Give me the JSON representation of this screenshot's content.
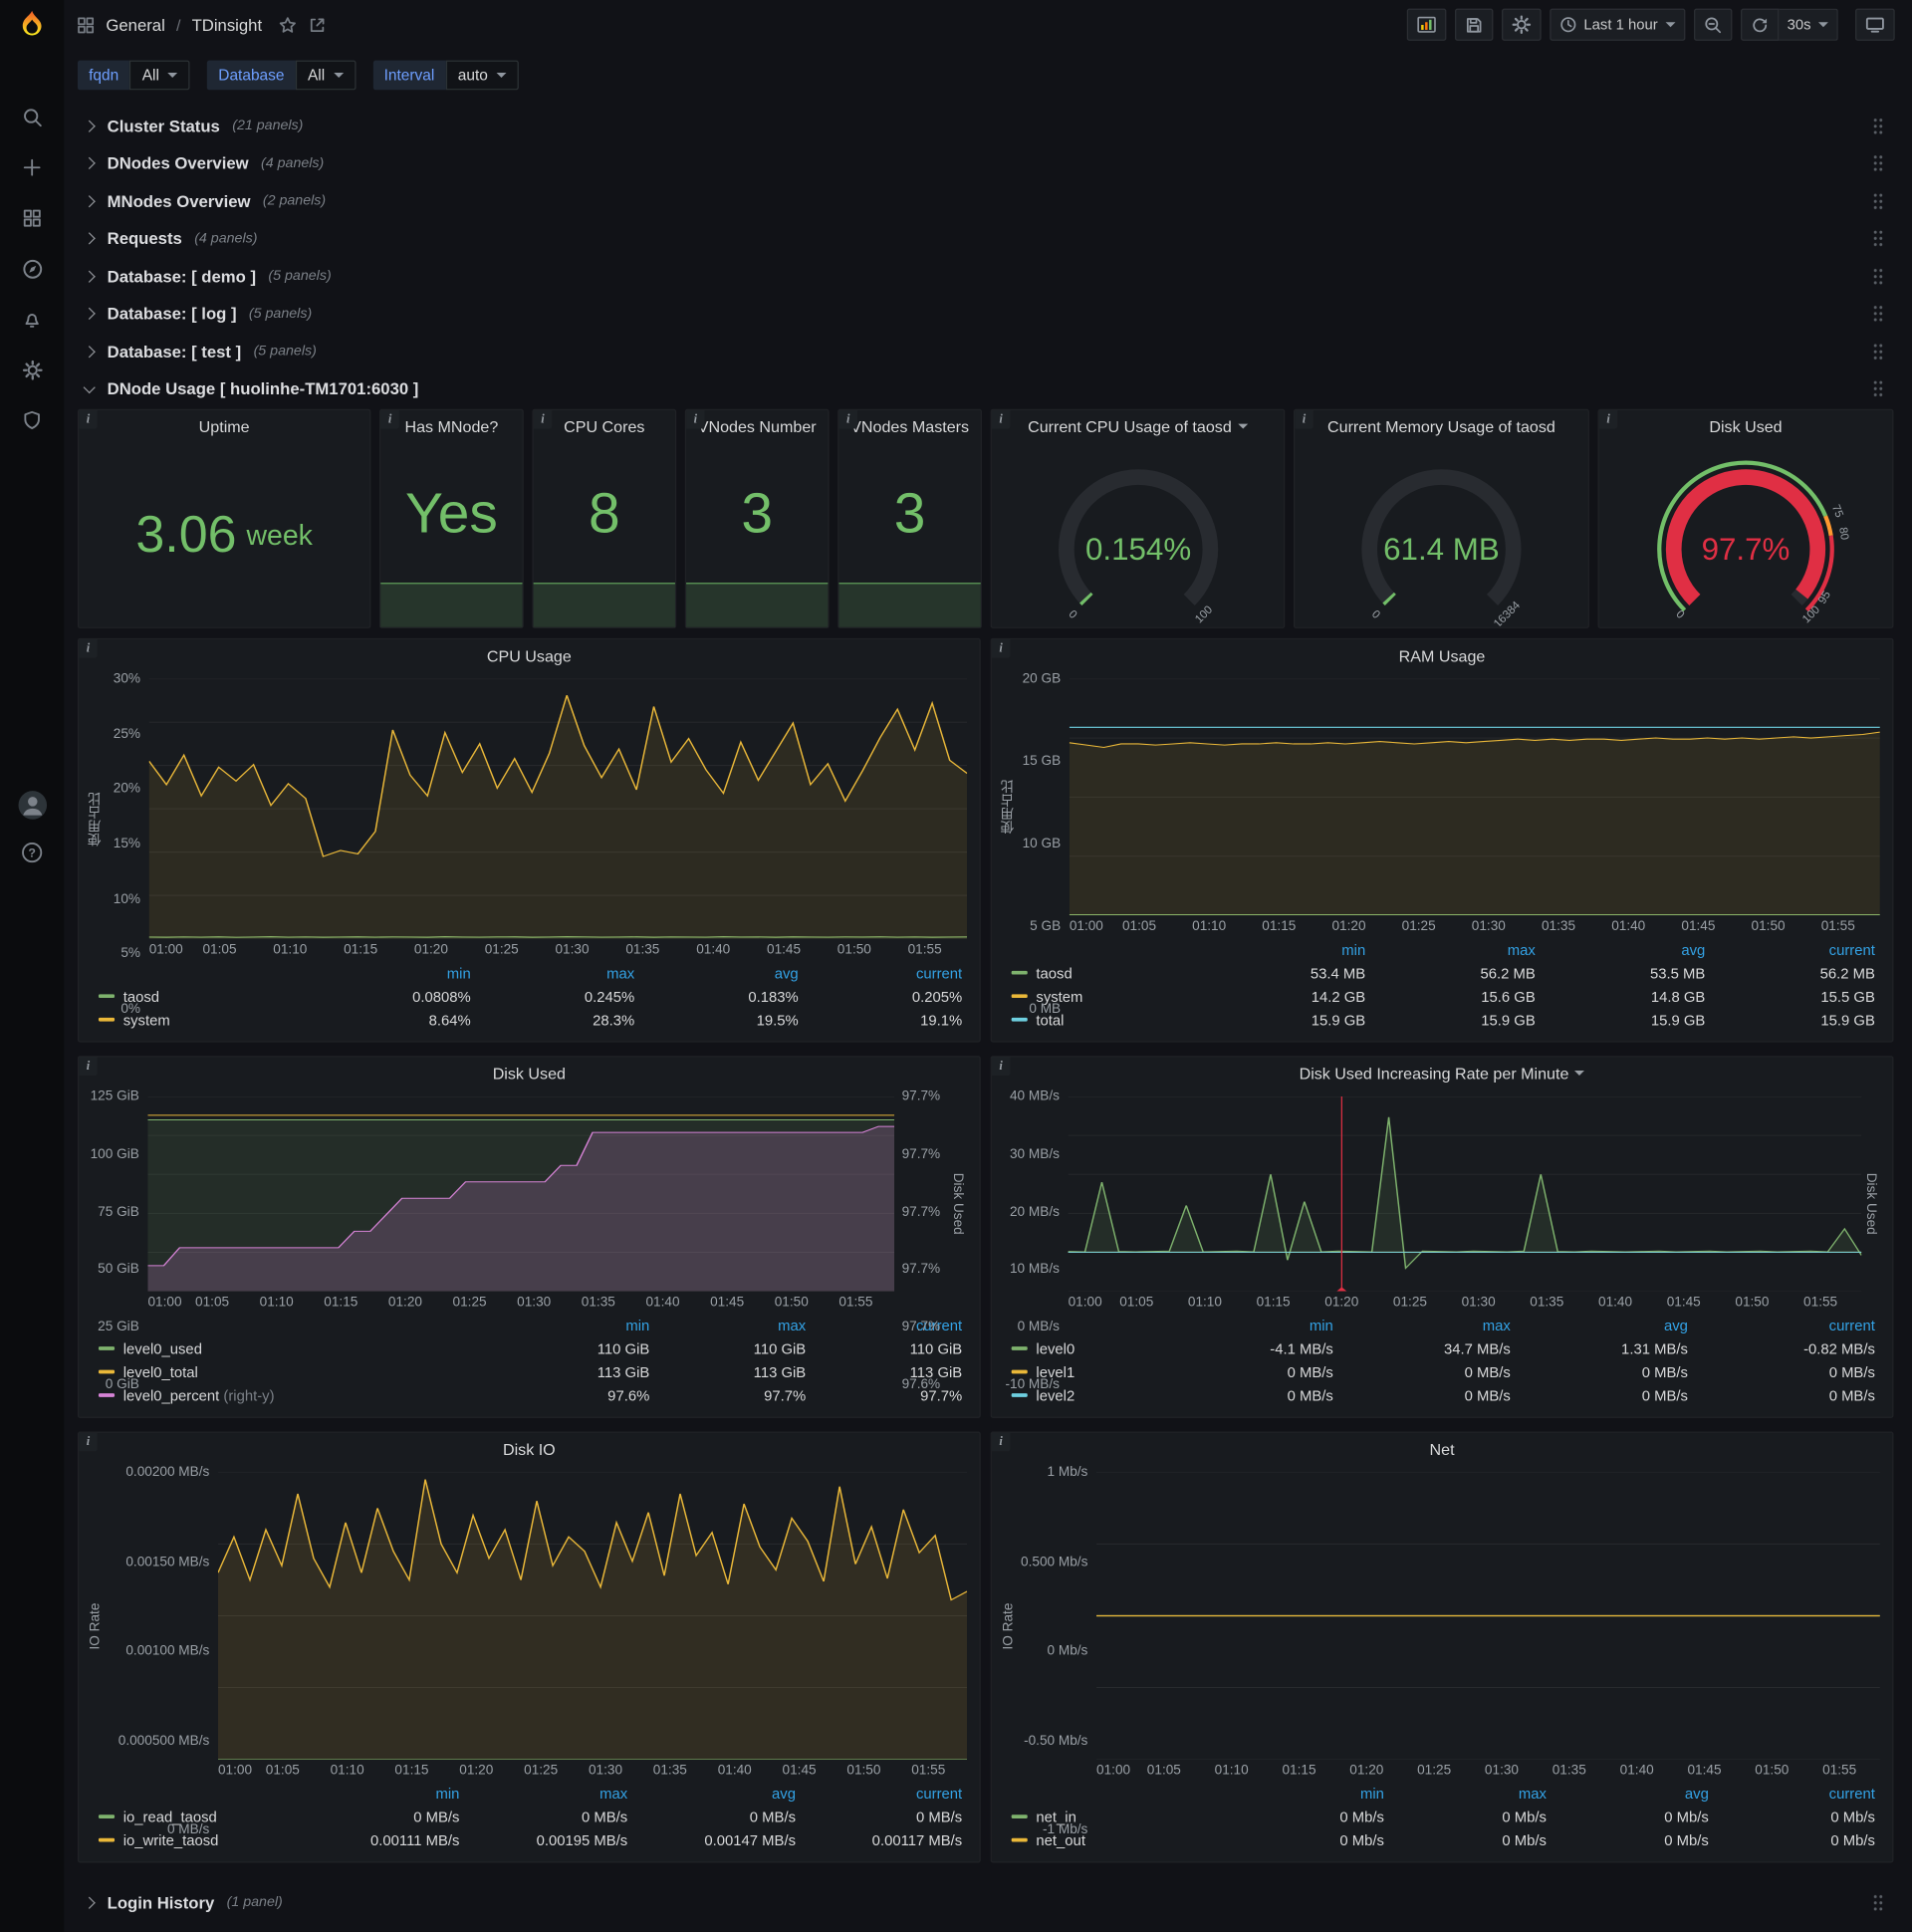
{
  "colors": {
    "brand_orange": "#f05a28",
    "green": "#73bf69",
    "series_green": "#7eb26d",
    "yellow": "#eab839",
    "cyan": "#6ed0e0",
    "pink": "#d683d6",
    "red": "#e02f44",
    "orange": "#ff9830",
    "legend_header_blue": "#33a2e5",
    "variable_blue": "#6e9fff"
  },
  "nav": {
    "section": "General",
    "separator": "/",
    "title": "TDinsight",
    "time_picker": "Last 1 hour",
    "refresh": "30s"
  },
  "variables": [
    {
      "name": "fqdn",
      "value": "All"
    },
    {
      "name": "Database",
      "value": "All"
    },
    {
      "name": "Interval",
      "value": "auto"
    }
  ],
  "rows_collapsed_top": [
    {
      "title": "Cluster Status",
      "count": "(21 panels)"
    },
    {
      "title": "DNodes Overview",
      "count": "(4 panels)"
    },
    {
      "title": "MNodes Overview",
      "count": "(2 panels)"
    },
    {
      "title": "Requests",
      "count": "(4 panels)"
    },
    {
      "title": "Database: [ demo ]",
      "count": "(5 panels)"
    },
    {
      "title": "Database: [ log ]",
      "count": "(5 panels)"
    },
    {
      "title": "Database: [ test ]",
      "count": "(5 panels)"
    }
  ],
  "expanded_row": {
    "title": "DNode Usage [ huolinhe-TM1701:6030 ]"
  },
  "rows_collapsed_bottom": [
    {
      "title": "Login History",
      "count": "(1 panel)"
    }
  ],
  "stats": {
    "uptime": {
      "title": "Uptime",
      "value": "3.06",
      "unit": "week"
    },
    "has_mnode": {
      "title": "Has MNode?",
      "value": "Yes"
    },
    "cpu_cores": {
      "title": "CPU Cores",
      "value": "8"
    },
    "vnodes_number": {
      "title": "VNodes Number",
      "value": "3"
    },
    "vnodes_masters": {
      "title": "VNodes Masters",
      "value": "3"
    }
  },
  "gauges": {
    "cpu": {
      "title": "Current CPU Usage of taosd",
      "value": "0.154%",
      "fraction": 0.0015,
      "min_label": "0",
      "max_label": "100",
      "color": "#73bf69",
      "caret": true
    },
    "mem": {
      "title": "Current Memory Usage of taosd",
      "value": "61.4 MB",
      "fraction": 0.0037,
      "min_label": "0",
      "max_label": "16384",
      "color": "#73bf69"
    },
    "disk": {
      "title": "Disk Used",
      "value": "97.7%",
      "fraction": 0.977,
      "min_label": "0",
      "max_label": "100",
      "color": "#e02f44",
      "thresholds": [
        {
          "from": 0,
          "to": 0.75,
          "color": "#73bf69"
        },
        {
          "from": 0.75,
          "to": 0.8,
          "color": "#ff9830"
        },
        {
          "from": 0.8,
          "to": 1,
          "color": "#e02f44"
        }
      ],
      "threshold_labels": [
        {
          "frac": 0.75,
          "label": "75"
        },
        {
          "frac": 0.8,
          "label": "80"
        },
        {
          "frac": 0.95,
          "label": "95"
        }
      ]
    }
  },
  "chart_data": [
    {
      "id": "cpu_usage",
      "type": "line",
      "title": "CPU Usage",
      "ylabel": "使用占比",
      "ylim": [
        0,
        30
      ],
      "ytick_w": 36,
      "yticks": [
        {
          "v": 0,
          "label": "0%"
        },
        {
          "v": 5,
          "label": "5%"
        },
        {
          "v": 10,
          "label": "10%"
        },
        {
          "v": 15,
          "label": "15%"
        },
        {
          "v": 20,
          "label": "20%"
        },
        {
          "v": 25,
          "label": "25%"
        },
        {
          "v": 30,
          "label": "30%"
        }
      ],
      "xticks": [
        "01:00",
        "01:05",
        "01:10",
        "01:15",
        "01:20",
        "01:25",
        "01:30",
        "01:35",
        "01:40",
        "01:45",
        "01:50",
        "01:55"
      ],
      "x_tick_minutes": 5,
      "x_total_minutes": 58,
      "legend_columns": [
        "min",
        "max",
        "avg",
        "current"
      ],
      "series": [
        {
          "name": "taosd",
          "color": "#7eb26d",
          "fill": 0.1,
          "stats": [
            "0.0808%",
            "0.245%",
            "0.183%",
            "0.205%"
          ],
          "values": [
            0.2,
            0.18,
            0.21,
            0.19,
            0.22,
            0.17,
            0.2,
            0.23,
            0.19,
            0.21,
            0.18,
            0.2,
            0.22,
            0.19,
            0.21,
            0.2,
            0.18,
            0.23,
            0.2,
            0.19,
            0.21,
            0.22,
            0.18,
            0.2,
            0.24,
            0.21,
            0.19,
            0.2,
            0.22,
            0.18,
            0.21,
            0.2,
            0.19,
            0.23,
            0.2,
            0.21,
            0.18,
            0.22,
            0.2,
            0.19,
            0.21,
            0.2,
            0.22,
            0.19,
            0.21,
            0.18,
            0.2,
            0.21
          ]
        },
        {
          "name": "system",
          "color": "#eab839",
          "fill": 0.1,
          "stats": [
            "8.64%",
            "28.3%",
            "19.5%",
            "19.1%"
          ],
          "values": [
            20.5,
            17.8,
            21.2,
            16.5,
            19.8,
            18.2,
            20.1,
            15.4,
            17.9,
            16.2,
            9.5,
            10.2,
            9.8,
            12.4,
            24.1,
            18.9,
            16.5,
            23.8,
            19.2,
            22.5,
            17.4,
            20.8,
            16.9,
            21.4,
            28.1,
            22.3,
            18.6,
            21.9,
            17.2,
            26.8,
            20.4,
            23.1,
            19.5,
            16.8,
            22.7,
            18.3,
            21.6,
            24.9,
            17.8,
            20.2,
            15.9,
            19.4,
            23.2,
            26.5,
            21.8,
            27.2,
            20.6,
            19.1
          ]
        }
      ]
    },
    {
      "id": "ram_usage",
      "type": "line",
      "title": "RAM Usage",
      "ylabel": "使用占比",
      "ylim": [
        0,
        20
      ],
      "ytick_w": 42,
      "yticks": [
        {
          "v": 0,
          "label": "0 MB"
        },
        {
          "v": 5,
          "label": "5 GB"
        },
        {
          "v": 10,
          "label": "10 GB"
        },
        {
          "v": 15,
          "label": "15 GB"
        },
        {
          "v": 20,
          "label": "20 GB"
        }
      ],
      "xticks": [
        "01:00",
        "01:05",
        "01:10",
        "01:15",
        "01:20",
        "01:25",
        "01:30",
        "01:35",
        "01:40",
        "01:45",
        "01:50",
        "01:55"
      ],
      "x_tick_minutes": 5,
      "x_total_minutes": 58,
      "legend_columns": [
        "min",
        "max",
        "avg",
        "current"
      ],
      "series": [
        {
          "name": "taosd",
          "color": "#7eb26d",
          "fill": 0.1,
          "stats": [
            "53.4 MB",
            "56.2 MB",
            "53.5 MB",
            "56.2 MB"
          ],
          "constant": 0.054,
          "points": 48
        },
        {
          "name": "system",
          "color": "#eab839",
          "fill": 0.1,
          "stats": [
            "14.2 GB",
            "15.6 GB",
            "14.8 GB",
            "15.5 GB"
          ],
          "values": [
            14.6,
            14.4,
            14.2,
            14.5,
            14.5,
            14.4,
            14.5,
            14.6,
            14.5,
            14.4,
            14.5,
            14.5,
            14.6,
            14.5,
            14.5,
            14.6,
            14.5,
            14.6,
            14.7,
            14.6,
            14.5,
            14.6,
            14.7,
            14.6,
            14.7,
            14.8,
            14.9,
            14.8,
            14.9,
            14.8,
            14.9,
            14.9,
            14.8,
            14.9,
            15.0,
            14.9,
            14.9,
            15.0,
            14.9,
            15.0,
            14.9,
            15.0,
            15.1,
            15.0,
            15.1,
            15.2,
            15.3,
            15.5
          ]
        },
        {
          "name": "total",
          "color": "#6ed0e0",
          "fill": 0,
          "stats": [
            "15.9 GB",
            "15.9 GB",
            "15.9 GB",
            "15.9 GB"
          ],
          "constant": 15.9,
          "points": 48
        }
      ]
    },
    {
      "id": "disk_used",
      "type": "line",
      "title": "Disk Used",
      "ylim": [
        0,
        125
      ],
      "ytick_w": 50,
      "yticks": [
        {
          "v": 0,
          "label": "0 GiB"
        },
        {
          "v": 25,
          "label": "25 GiB"
        },
        {
          "v": 50,
          "label": "50 GiB"
        },
        {
          "v": 75,
          "label": "75 GiB"
        },
        {
          "v": 100,
          "label": "100 GiB"
        },
        {
          "v": 125,
          "label": "125 GiB"
        }
      ],
      "y2label": "Disk Used",
      "y2lim": [
        97.59,
        97.72
      ],
      "y2tick_w": 44,
      "y2ticks": [
        {
          "v": 97.59,
          "label": "97.6%"
        },
        {
          "v": 97.616,
          "label": "97.7%"
        },
        {
          "v": 97.642,
          "label": "97.7%"
        },
        {
          "v": 97.668,
          "label": "97.7%"
        },
        {
          "v": 97.694,
          "label": "97.7%"
        },
        {
          "v": 97.72,
          "label": "97.7%"
        }
      ],
      "xticks": [
        "01:00",
        "01:05",
        "01:10",
        "01:15",
        "01:20",
        "01:25",
        "01:30",
        "01:35",
        "01:40",
        "01:45",
        "01:50",
        "01:55"
      ],
      "x_tick_minutes": 5,
      "x_total_minutes": 58,
      "legend_columns": [
        "min",
        "max",
        "current"
      ],
      "series": [
        {
          "name": "level0_used",
          "color": "#7eb26d",
          "fill": 0.12,
          "stats": [
            "110 GiB",
            "110 GiB",
            "110 GiB"
          ],
          "constant": 110,
          "points": 48
        },
        {
          "name": "level0_total",
          "color": "#eab839",
          "fill": 0,
          "stats": [
            "113 GiB",
            "113 GiB",
            "113 GiB"
          ],
          "constant": 113,
          "points": 48
        },
        {
          "name": "level0_percent",
          "suffix": "(right-y)",
          "axis": "right",
          "color": "#d683d6",
          "fill": 0.2,
          "stats": [
            "97.6%",
            "97.7%",
            "97.7%"
          ],
          "values": [
            97.607,
            97.607,
            97.619,
            97.619,
            97.619,
            97.619,
            97.619,
            97.619,
            97.619,
            97.619,
            97.619,
            97.619,
            97.619,
            97.63,
            97.63,
            97.641,
            97.652,
            97.652,
            97.652,
            97.652,
            97.663,
            97.663,
            97.663,
            97.663,
            97.663,
            97.663,
            97.674,
            97.674,
            97.696,
            97.696,
            97.696,
            97.696,
            97.696,
            97.696,
            97.696,
            97.696,
            97.696,
            97.696,
            97.696,
            97.696,
            97.696,
            97.696,
            97.696,
            97.696,
            97.696,
            97.696,
            97.7,
            97.7
          ]
        }
      ]
    },
    {
      "id": "disk_rate",
      "type": "line",
      "title": "Disk Used Increasing Rate per Minute",
      "caret": true,
      "ylim": [
        -10,
        40
      ],
      "ytick_w": 56,
      "yticks": [
        {
          "v": -10,
          "label": "-10 MB/s"
        },
        {
          "v": 0,
          "label": "0 MB/s"
        },
        {
          "v": 10,
          "label": "10 MB/s"
        },
        {
          "v": 20,
          "label": "20 MB/s"
        },
        {
          "v": 30,
          "label": "30 MB/s"
        },
        {
          "v": 40,
          "label": "40 MB/s"
        }
      ],
      "y2label": "Disk Used",
      "xticks": [
        "01:00",
        "01:05",
        "01:10",
        "01:15",
        "01:20",
        "01:25",
        "01:30",
        "01:35",
        "01:40",
        "01:45",
        "01:50",
        "01:55"
      ],
      "x_tick_minutes": 5,
      "x_total_minutes": 58,
      "annotations": [
        {
          "minute": 20,
          "color": "#e02f44"
        }
      ],
      "legend_columns": [
        "min",
        "max",
        "avg",
        "current"
      ],
      "series": [
        {
          "name": "level0",
          "color": "#7eb26d",
          "fill": 0.12,
          "stats": [
            "-4.1 MB/s",
            "34.7 MB/s",
            "1.31 MB/s",
            "-0.82 MB/s"
          ],
          "values": [
            0.2,
            0.1,
            18,
            0.2,
            0.1,
            0.2,
            0.3,
            12,
            0.1,
            0.2,
            0.3,
            0.1,
            20,
            -2,
            13,
            0.1,
            0.3,
            0.2,
            0.1,
            34.7,
            -4.1,
            0.3,
            0.2,
            0.1,
            0.3,
            0.2,
            0.1,
            0.3,
            20,
            0.2,
            0.1,
            0.3,
            0.2,
            0.1,
            0.2,
            0.3,
            0.1,
            0.2,
            0.3,
            0.1,
            0.2,
            0.3,
            0.1,
            0.2,
            0.3,
            0.1,
            6,
            -0.82
          ]
        },
        {
          "name": "level1",
          "color": "#eab839",
          "fill": 0,
          "stats": [
            "0 MB/s",
            "0 MB/s",
            "0 MB/s",
            "0 MB/s"
          ],
          "constant": 0,
          "points": 48
        },
        {
          "name": "level2",
          "color": "#6ed0e0",
          "fill": 0,
          "stats": [
            "0 MB/s",
            "0 MB/s",
            "0 MB/s",
            "0 MB/s"
          ],
          "constant": 0,
          "points": 48
        }
      ]
    },
    {
      "id": "disk_io",
      "type": "line",
      "title": "Disk IO",
      "ylabel": "IO Rate",
      "ylim": [
        0,
        0.002
      ],
      "ytick_w": 92,
      "yticks": [
        {
          "v": 0,
          "label": "0 MB/s"
        },
        {
          "v": 0.0005,
          "label": "0.000500 MB/s"
        },
        {
          "v": 0.001,
          "label": "0.00100 MB/s"
        },
        {
          "v": 0.0015,
          "label": "0.00150 MB/s"
        },
        {
          "v": 0.002,
          "label": "0.00200 MB/s"
        }
      ],
      "xticks": [
        "01:00",
        "01:05",
        "01:10",
        "01:15",
        "01:20",
        "01:25",
        "01:30",
        "01:35",
        "01:40",
        "01:45",
        "01:50",
        "01:55"
      ],
      "x_tick_minutes": 5,
      "x_total_minutes": 58,
      "legend_columns": [
        "min",
        "max",
        "avg",
        "current"
      ],
      "series": [
        {
          "name": "io_read_taosd",
          "color": "#7eb26d",
          "fill": 0.1,
          "stats": [
            "0 MB/s",
            "0 MB/s",
            "0 MB/s",
            "0 MB/s"
          ],
          "constant": 0,
          "points": 48
        },
        {
          "name": "io_write_taosd",
          "color": "#eab839",
          "fill": 0.12,
          "stats": [
            "0.00111 MB/s",
            "0.00195 MB/s",
            "0.00147 MB/s",
            "0.00117 MB/s"
          ],
          "values": [
            0.0013,
            0.00155,
            0.00125,
            0.0016,
            0.00135,
            0.00185,
            0.0014,
            0.0012,
            0.00165,
            0.0013,
            0.00175,
            0.00145,
            0.00125,
            0.00195,
            0.0015,
            0.0013,
            0.0017,
            0.0014,
            0.0016,
            0.00125,
            0.0018,
            0.00135,
            0.00155,
            0.00145,
            0.0012,
            0.00165,
            0.00138,
            0.00172,
            0.00128,
            0.00185,
            0.00142,
            0.00158,
            0.00122,
            0.00178,
            0.00148,
            0.00132,
            0.00168,
            0.00152,
            0.00124,
            0.0019,
            0.00136,
            0.00162,
            0.00126,
            0.00174,
            0.00144,
            0.00156,
            0.00111,
            0.00117
          ]
        }
      ]
    },
    {
      "id": "net",
      "type": "line",
      "title": "Net",
      "ylabel": "IO Rate",
      "ylim": [
        -1,
        1
      ],
      "ytick_w": 64,
      "yticks": [
        {
          "v": -1,
          "label": "-1 Mb/s"
        },
        {
          "v": -0.5,
          "label": "-0.50 Mb/s"
        },
        {
          "v": 0,
          "label": "0 Mb/s"
        },
        {
          "v": 0.5,
          "label": "0.500 Mb/s"
        },
        {
          "v": 1,
          "label": "1 Mb/s"
        }
      ],
      "xticks": [
        "01:00",
        "01:05",
        "01:10",
        "01:15",
        "01:20",
        "01:25",
        "01:30",
        "01:35",
        "01:40",
        "01:45",
        "01:50",
        "01:55"
      ],
      "x_tick_minutes": 5,
      "x_total_minutes": 58,
      "legend_columns": [
        "min",
        "max",
        "avg",
        "current"
      ],
      "series": [
        {
          "name": "net_in",
          "color": "#7eb26d",
          "fill": 0,
          "stats": [
            "0 Mb/s",
            "0 Mb/s",
            "0 Mb/s",
            "0 Mb/s"
          ],
          "constant": 0,
          "points": 48
        },
        {
          "name": "net_out",
          "color": "#eab839",
          "fill": 0,
          "stats": [
            "0 Mb/s",
            "0 Mb/s",
            "0 Mb/s",
            "0 Mb/s"
          ],
          "constant": 0,
          "points": 48
        }
      ]
    }
  ]
}
